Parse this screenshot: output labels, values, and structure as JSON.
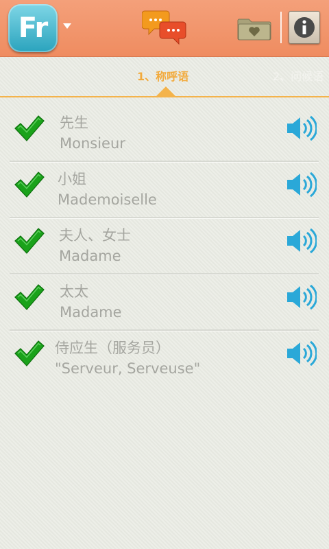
{
  "header": {
    "logo_text": "Fr",
    "icons": {
      "language_dropdown": "chevron-down-icon",
      "phrases": "chat-bubbles-icon",
      "favorites": "heart-folder-icon",
      "info": "info-icon"
    },
    "colors": {
      "bar": "#ef8c60",
      "logo": "#2aa3bd"
    }
  },
  "tabs": [
    {
      "label": "1、称呼语",
      "active": true
    },
    {
      "label": "2、问候语",
      "active": false
    }
  ],
  "colors": {
    "active_tab": "#f2aa3c",
    "check": "#1aa21a",
    "speaker": "#2aa8d8",
    "text": "#a5a6a0"
  },
  "phrases": [
    {
      "zh": "先生",
      "fr": "Monsieur",
      "checked": true
    },
    {
      "zh": "小姐",
      "fr": "Mademoiselle",
      "checked": true
    },
    {
      "zh": "夫人、女士",
      "fr": "Madame",
      "checked": true
    },
    {
      "zh": "太太",
      "fr": "Madame",
      "checked": true
    },
    {
      "zh": "侍应生（服务员）",
      "fr": "\"Serveur, Serveuse\"",
      "checked": true
    }
  ]
}
